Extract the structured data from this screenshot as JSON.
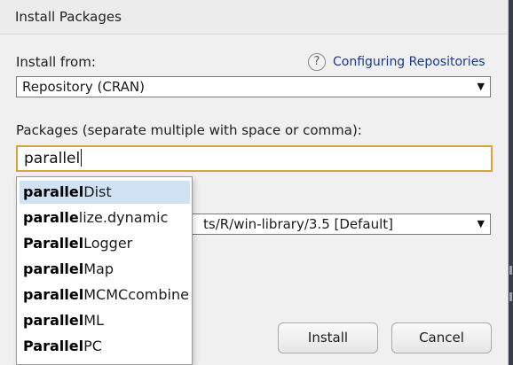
{
  "window": {
    "title": "Install Packages"
  },
  "install_from": {
    "label": "Install from:",
    "value": "Repository (CRAN)",
    "help_icon": "question-mark-icon",
    "help_link": "Configuring Repositories"
  },
  "packages": {
    "label": "Packages (separate multiple with space or comma):",
    "value": "parallel"
  },
  "install_to_library": {
    "visible_value": "ts/R/win-library/3.5 [Default]"
  },
  "autocomplete": {
    "items": [
      {
        "match": "parallel",
        "rest": "Dist",
        "selected": true
      },
      {
        "match": "paralle",
        "rest": "lize.dynamic",
        "selected": false
      },
      {
        "match": "Parallel",
        "rest": "Logger",
        "selected": false
      },
      {
        "match": "parallel",
        "rest": "Map",
        "selected": false
      },
      {
        "match": "parallel",
        "rest": "MCMCcombine",
        "selected": false
      },
      {
        "match": "parallel",
        "rest": "ML",
        "selected": false
      },
      {
        "match": "Parallel",
        "rest": "PC",
        "selected": false
      }
    ]
  },
  "buttons": {
    "install": "Install",
    "cancel": "Cancel"
  },
  "colors": {
    "input_focus_border": "#d9a23a",
    "selected_item_bg": "#cfe3f5",
    "link": "#1b3a8c"
  }
}
